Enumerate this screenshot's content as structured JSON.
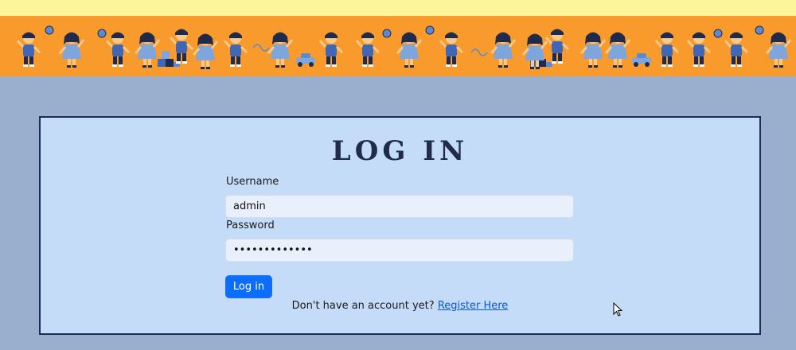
{
  "page": {
    "title": "LOG IN",
    "username_label": "Username",
    "username_value": "admin",
    "password_label": "Password",
    "password_value": "•••••••••••••",
    "login_button": "Log in",
    "register_prompt": "Don't have an account yet?",
    "register_link": "Register Here"
  },
  "colors": {
    "banner": "#f99a2c",
    "top_strip": "#fdf59a",
    "background": "#9aafcd",
    "card": "#c5dcf8",
    "accent": "#0d6efd"
  },
  "icons": [
    "mouse-cursor-icon"
  ]
}
